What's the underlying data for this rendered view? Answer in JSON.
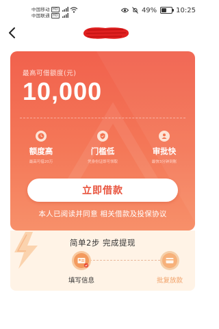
{
  "status_bar": {
    "carrier1": "中国移动",
    "carrier2": "中国联通",
    "network_tag": "HD",
    "battery_text": "49%",
    "battery_level": 0.49,
    "time": "10:25",
    "icons": [
      "eye-icon",
      "mute-icon",
      "battery-icon"
    ]
  },
  "nav": {
    "back_icon": "back-arrow-icon"
  },
  "loan_card": {
    "limit_label": "最高可借额度(元)",
    "limit_amount": "10,000",
    "features": [
      {
        "icon": "clock-icon",
        "title": "额度高",
        "subtitle": "最高可借20万"
      },
      {
        "icon": "shield-icon",
        "title": "门槛低",
        "subtitle": "凭身份证即可领取"
      },
      {
        "icon": "person-icon",
        "title": "审批快",
        "subtitle": "最快3分钟到账"
      }
    ],
    "apply_button": "立即借款",
    "agreement": {
      "prefix": "本人已阅读并同意",
      "link": "相关借款及投保协议"
    }
  },
  "steps": {
    "title": "简单2步  完成提现",
    "items": [
      {
        "icon": "id-card-icon",
        "label": "填写信息",
        "status": "done"
      },
      {
        "icon": "card-icon",
        "label": "批复放款",
        "status": "pending"
      }
    ]
  },
  "colors": {
    "card_top": "#f1614d",
    "card_bottom": "#f7906a",
    "accent": "#e8533d",
    "steps_bg": "#fff3e6"
  }
}
